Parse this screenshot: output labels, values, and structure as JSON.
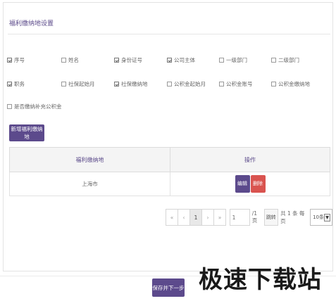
{
  "section": {
    "title": "福利缴纳地设置"
  },
  "fields": [
    {
      "label": "序号",
      "checked": true
    },
    {
      "label": "姓名",
      "checked": false
    },
    {
      "label": "身份证号",
      "checked": true
    },
    {
      "label": "公司主体",
      "checked": true
    },
    {
      "label": "一级部门",
      "checked": false
    },
    {
      "label": "二级部门",
      "checked": false
    },
    {
      "label": "职务",
      "checked": true
    },
    {
      "label": "社保起始月",
      "checked": false
    },
    {
      "label": "社保缴纳地",
      "checked": true
    },
    {
      "label": "公积金起始月",
      "checked": false
    },
    {
      "label": "公积金账号",
      "checked": false
    },
    {
      "label": "公积金缴纳地",
      "checked": false
    },
    {
      "label": "是否缴纳补充公积金",
      "checked": false
    }
  ],
  "add_button": {
    "label": "新增福利缴纳地"
  },
  "table": {
    "headers": [
      "福利缴纳地",
      "操作"
    ],
    "rows": [
      {
        "location": "上海市",
        "edit_label": "编辑",
        "delete_label": "删除"
      }
    ]
  },
  "pagination": {
    "first": "«",
    "prev": "‹",
    "current": "1",
    "next": "›",
    "last": "»",
    "page_input": "1",
    "total_pages_text": "/1页",
    "jump_label": "跳转",
    "summary": "共 1 条 每页",
    "page_size": "10条"
  },
  "save_button": {
    "label": "保存并下一步"
  },
  "watermark": {
    "text": "极速下载站"
  }
}
